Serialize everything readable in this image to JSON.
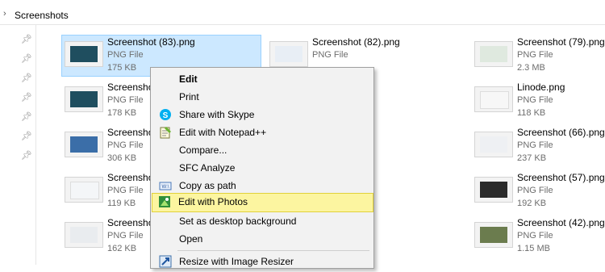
{
  "address": {
    "current_folder": "Screenshots"
  },
  "files": [
    {
      "name": "Screenshot (83).png",
      "type": "PNG File",
      "size": "175 KB",
      "selected": true
    },
    {
      "name": "Screenshot (82).png",
      "type": "PNG File",
      "size": ""
    },
    {
      "name": "Screenshot (79).png",
      "type": "PNG File",
      "size": "2.3 MB"
    },
    {
      "name": "Screenshot",
      "type": "PNG File",
      "size": "178 KB"
    },
    {
      "name": "",
      "type": "",
      "size": ""
    },
    {
      "name": "Linode.png",
      "type": "PNG File",
      "size": "118 KB"
    },
    {
      "name": "Screenshot",
      "type": "PNG File",
      "size": "306 KB"
    },
    {
      "name": "",
      "type": "",
      "size": ""
    },
    {
      "name": "Screenshot (66).png",
      "type": "PNG File",
      "size": "237 KB"
    },
    {
      "name": "Screenshot",
      "type": "PNG File",
      "size": "119 KB"
    },
    {
      "name": "",
      "type": "",
      "size": ""
    },
    {
      "name": "Screenshot (57).png",
      "type": "PNG File",
      "size": "192 KB"
    },
    {
      "name": "Screenshot",
      "type": "PNG File",
      "size": "162 KB"
    },
    {
      "name": "",
      "type": "",
      "size": ""
    },
    {
      "name": "Screenshot (42).png",
      "type": "PNG File",
      "size": "1.15 MB"
    }
  ],
  "context_menu": {
    "items": [
      {
        "label": "Edit",
        "icon": "none",
        "bold": true
      },
      {
        "label": "Print",
        "icon": "none"
      },
      {
        "label": "Share with Skype",
        "icon": "skype-icon"
      },
      {
        "label": "Edit with Notepad++",
        "icon": "notepad-plus-plus-icon"
      },
      {
        "label": "Compare...",
        "icon": "none"
      },
      {
        "label": "SFC Analyze",
        "icon": "none"
      },
      {
        "label": "Copy as path",
        "icon": "copy-path-icon"
      },
      {
        "label": "Edit with Photos",
        "icon": "photos-icon",
        "highlighted": true
      },
      {
        "label": "Set as desktop background",
        "icon": "none"
      },
      {
        "label": "Open",
        "icon": "none"
      },
      {
        "label": "Resize with Image Resizer",
        "icon": "image-resizer-icon"
      }
    ]
  },
  "colors": {
    "selection_bg": "#cce8ff",
    "selection_border": "#99d1ff",
    "highlight_bg": "#fcf5a0",
    "highlight_border": "#e1d13a",
    "menu_bg": "#f2f2f2"
  }
}
